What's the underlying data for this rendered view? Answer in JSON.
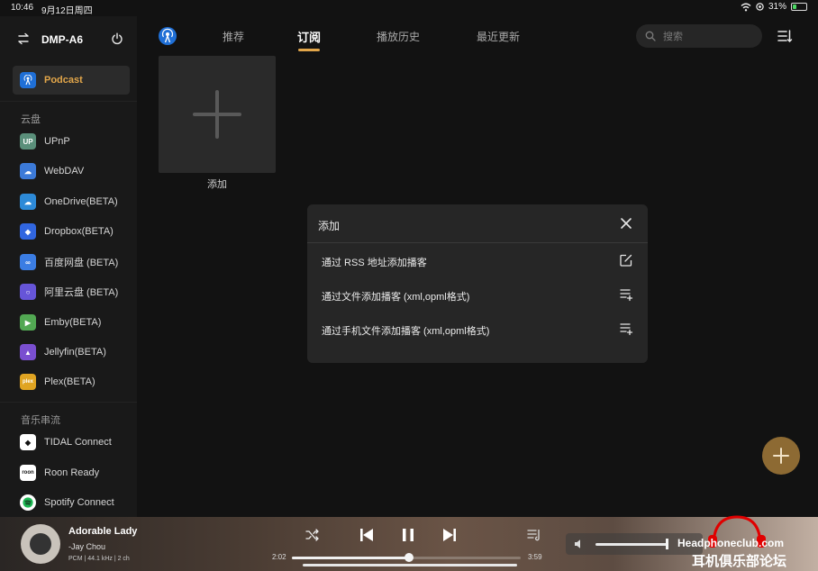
{
  "status_bar": {
    "time": "10:46",
    "date": "9月12日周四",
    "battery": "31%",
    "battery_level": 0.31
  },
  "sidebar": {
    "device_name": "DMP-A6",
    "podcast": {
      "label": "Podcast",
      "icon": "podcast-icon"
    },
    "cloud_section": "云盘",
    "cloud_items": [
      {
        "label": "UPnP",
        "icon": "upnp-icon",
        "color": "#5a8f7a"
      },
      {
        "label": "WebDAV",
        "icon": "webdav-icon",
        "color": "#3c7ad8"
      },
      {
        "label": "OneDrive(BETA)",
        "icon": "onedrive-icon",
        "color": "#2d8ad8"
      },
      {
        "label": "Dropbox(BETA)",
        "icon": "dropbox-icon",
        "color": "#3166e0"
      },
      {
        "label": "百度网盘 (BETA)",
        "icon": "baidu-icon",
        "color": "#3b7de3"
      },
      {
        "label": "阿里云盘 (BETA)",
        "icon": "aliyun-icon",
        "color": "#6655d8"
      },
      {
        "label": "Emby(BETA)",
        "icon": "emby-icon",
        "color": "#52a853"
      },
      {
        "label": "Jellyfin(BETA)",
        "icon": "jellyfin-icon",
        "color": "#7a4fd0"
      },
      {
        "label": "Plex(BETA)",
        "icon": "plex-icon",
        "color": "#e0a422"
      }
    ],
    "stream_section": "音乐串流",
    "stream_items": [
      {
        "label": "TIDAL Connect",
        "icon": "tidal-icon",
        "color": "#ffffff"
      },
      {
        "label": "Roon Ready",
        "icon": "roon-icon",
        "color": "#ffffff"
      },
      {
        "label": "Spotify Connect",
        "icon": "spotify-icon",
        "color": "#ffffff"
      }
    ]
  },
  "tabs": {
    "items": [
      "推荐",
      "订阅",
      "播放历史",
      "最近更新"
    ],
    "active": "订阅",
    "search_placeholder": "搜索"
  },
  "content": {
    "add_label": "添加"
  },
  "dialog": {
    "title": "添加",
    "options": [
      {
        "label": "通过 RSS 地址添加播客",
        "icon": "edit-icon"
      },
      {
        "label": "通过文件添加播客 (xml,opml格式)",
        "icon": "playlist-add-icon"
      },
      {
        "label": "通过手机文件添加播客 (xml,opml格式)",
        "icon": "playlist-add-icon"
      }
    ]
  },
  "player": {
    "title": "Adorable Lady",
    "artist": "-Jay Chou",
    "format": "PCM | 44.1 kHz | 2 ch",
    "elapsed": "2:02",
    "duration": "3:59",
    "progress": 0.51,
    "volume": 0.97
  },
  "watermark": {
    "en": "Headphoneclub.com",
    "zh": "耳机俱乐部论坛"
  },
  "colors": {
    "accent": "#e2a64a",
    "fab": "#8d6a33"
  }
}
